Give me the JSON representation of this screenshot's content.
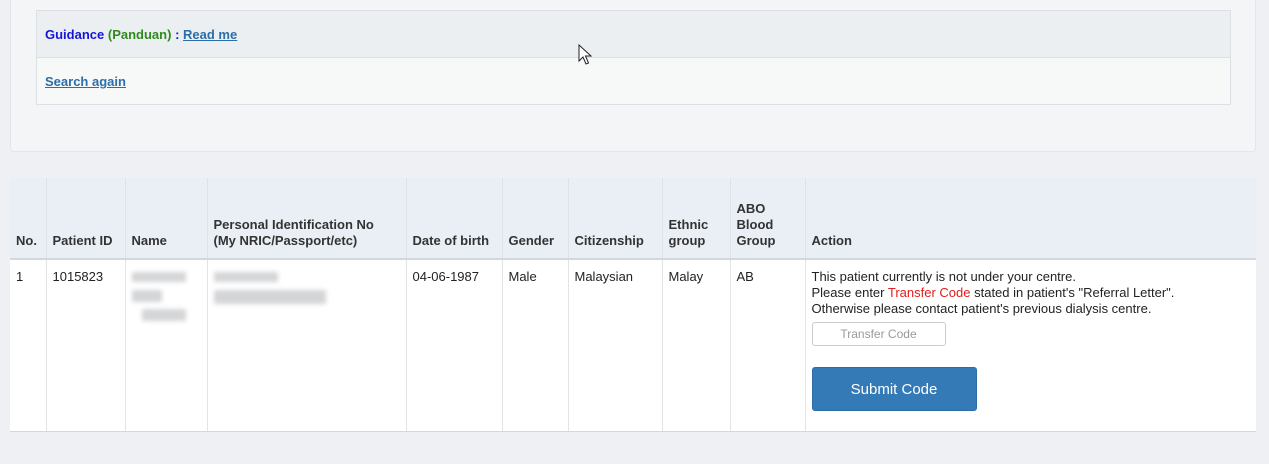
{
  "guidance": {
    "label": "Guidance",
    "label_malay": "(Panduan)",
    "separator": ":",
    "read_me_link": "Read me",
    "search_again_link": "Search again"
  },
  "table": {
    "headers": {
      "no": "No.",
      "patient_id": "Patient ID",
      "name": "Name",
      "personal_id": "Personal Identification No (My NRIC/Passport/etc)",
      "dob": "Date of birth",
      "gender": "Gender",
      "citizenship": "Citizenship",
      "ethnic": "Ethnic group",
      "blood": "ABO Blood Group",
      "action": "Action"
    },
    "rows": [
      {
        "no": "1",
        "patient_id": "1015823",
        "dob": "04-06-1987",
        "gender": "Male",
        "citizenship": "Malaysian",
        "ethnic": "Malay",
        "blood": "AB",
        "action": {
          "line1": "This patient currently is not under your centre.",
          "line2_pre": "Please enter ",
          "line2_highlight": "Transfer Code",
          "line2_post": " stated in patient's \"Referral Letter\".",
          "line3": "Otherwise please contact patient's previous dialysis centre.",
          "transfer_code_placeholder": "Transfer Code",
          "submit_label": "Submit Code"
        }
      }
    ]
  },
  "colors": {
    "primary_button": "#337ab7",
    "highlight_text": "#e02020",
    "guidance_label": "#1515d8",
    "guidance_malay": "#2e8b1e",
    "link": "#2c6ea8"
  }
}
